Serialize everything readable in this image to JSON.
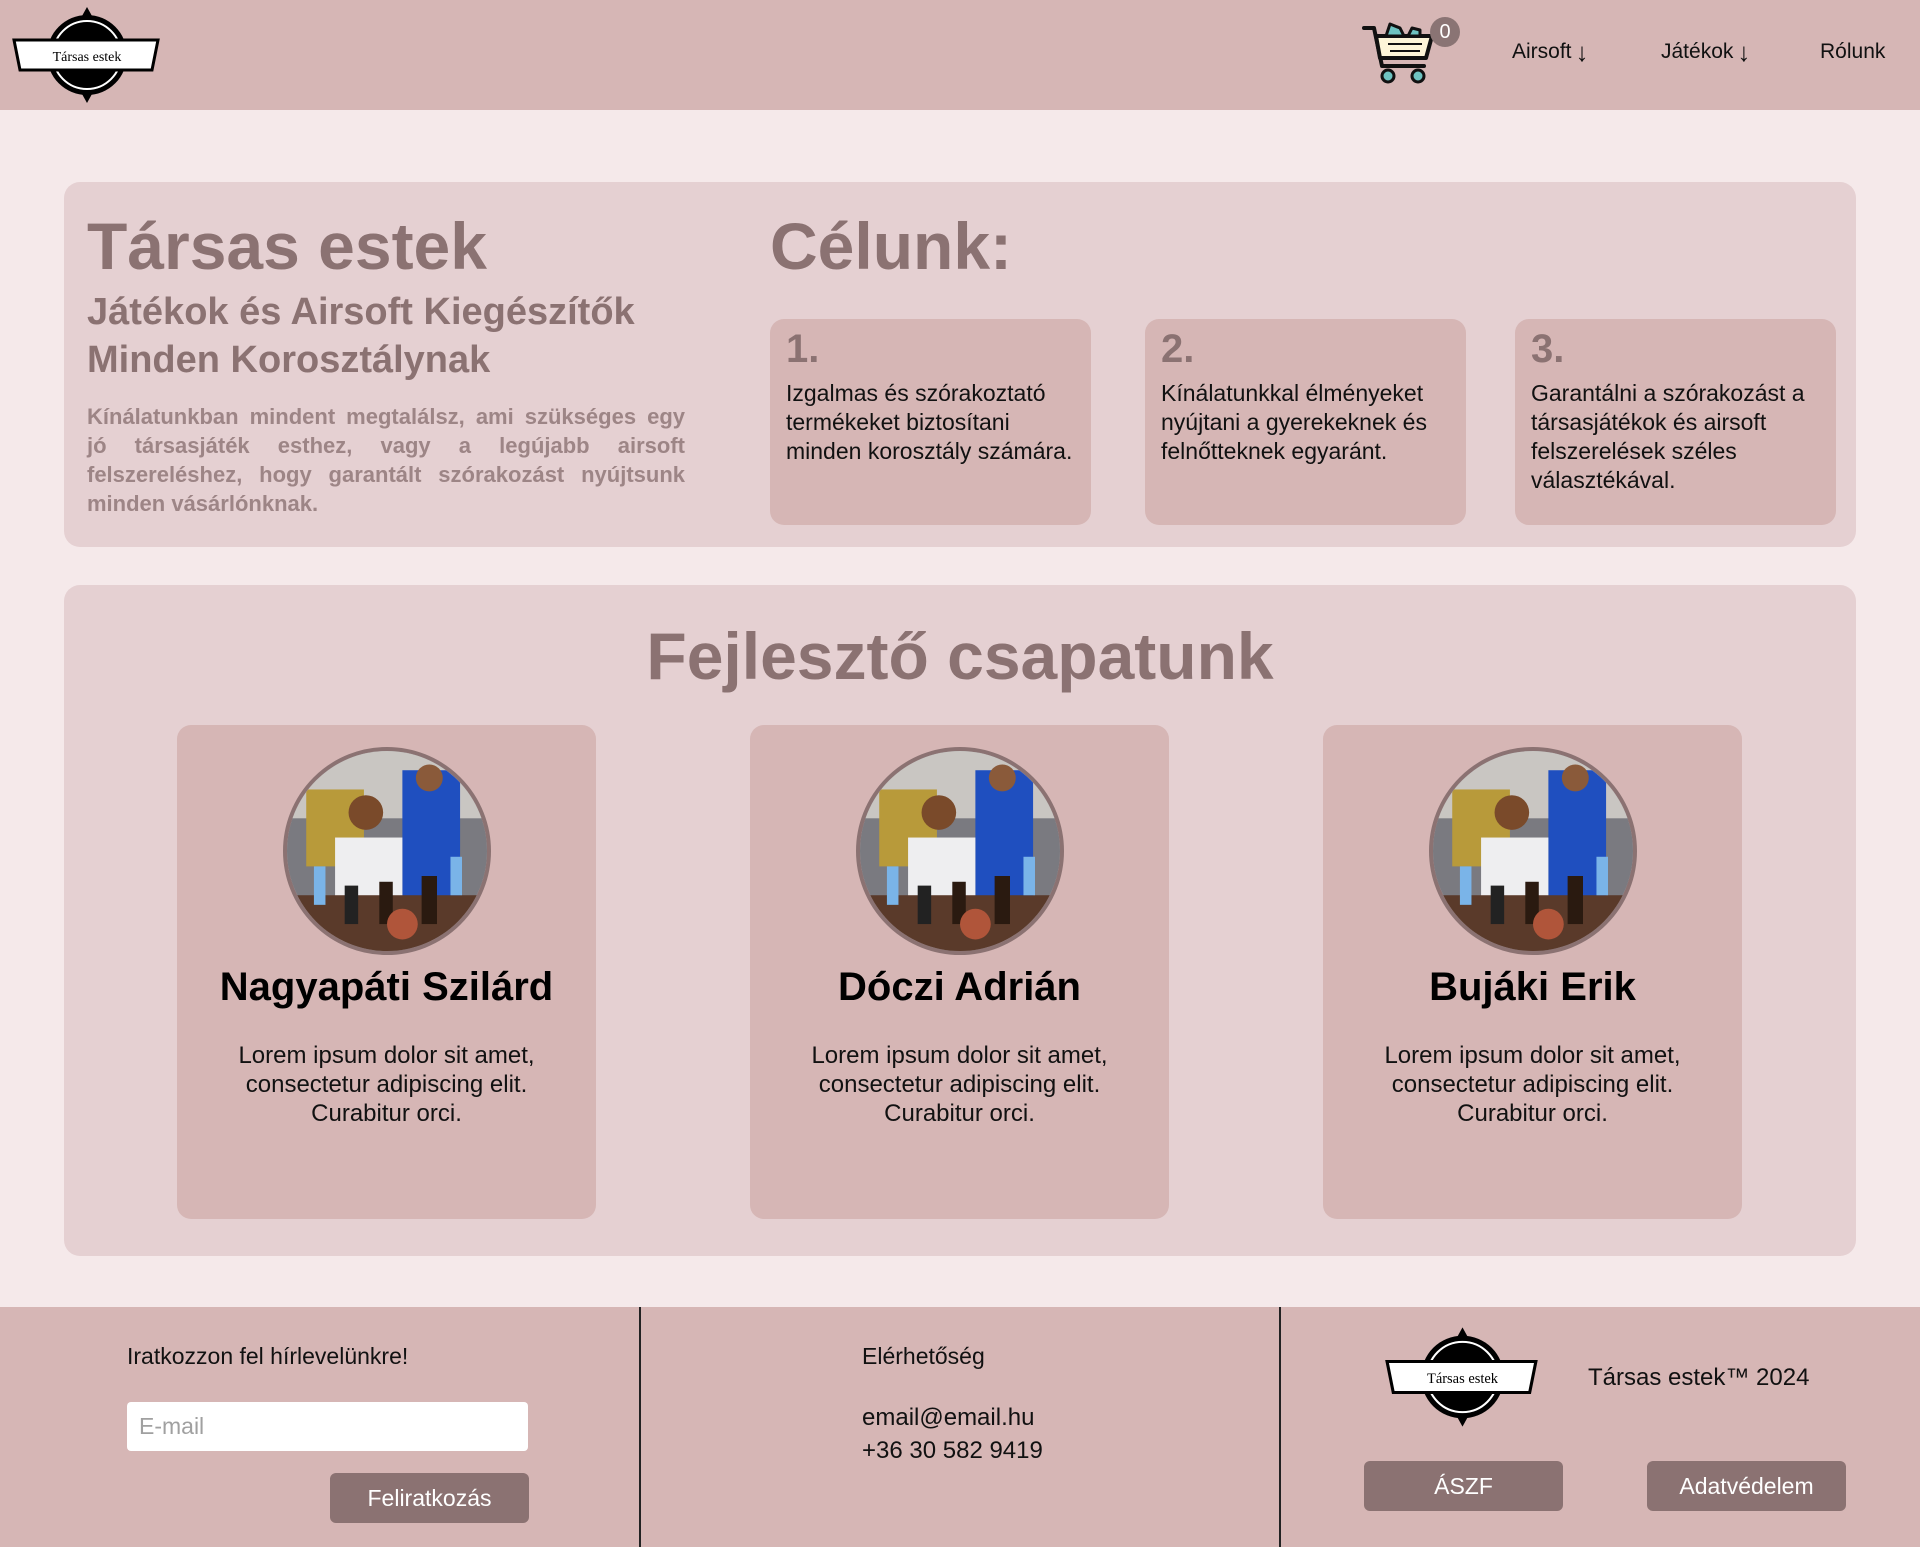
{
  "brand": {
    "logo_text": "Társas estek"
  },
  "header": {
    "cart_count": "0",
    "nav": [
      {
        "label": "Airsoft",
        "arrow": "↓"
      },
      {
        "label": "Játékok",
        "arrow": "↓"
      },
      {
        "label": "Rólunk",
        "arrow": ""
      }
    ]
  },
  "hero": {
    "title": "Társas estek",
    "subtitle": "Játékok és Airsoft Kiegészítők Minden Korosztálynak",
    "description": "Kínálatunkban mindent megtalálsz, ami szükséges egy jó társasjáték esthez, vagy a legújabb airsoft felszereléshez, hogy garantált szórakozást nyújtsunk minden vásárlónknak."
  },
  "goals": {
    "title": "Célunk:",
    "items": [
      {
        "num": "1.",
        "text": "Izgalmas és szórakoztató termékeket biztosítani minden korosztály számára."
      },
      {
        "num": "2.",
        "text": "Kínálatunkkal élményeket nyújtani a gyerekeknek és felnőtteknek egyaránt."
      },
      {
        "num": "3.",
        "text": "Garantálni a szórakozást a társasjátékok és airsoft felszerelések széles választékával."
      }
    ]
  },
  "team": {
    "title": "Fejlesztő csapatunk",
    "members": [
      {
        "name": "Nagyapáti Szilárd",
        "text": "Lorem ipsum dolor sit amet, consectetur adipiscing elit. Curabitur orci."
      },
      {
        "name": "Dóczi Adrián",
        "text": "Lorem ipsum dolor sit amet, consectetur adipiscing elit. Curabitur orci."
      },
      {
        "name": "Bujáki Erik",
        "text": "Lorem ipsum dolor sit amet, consectetur adipiscing elit. Curabitur orci."
      }
    ]
  },
  "footer": {
    "newsletter_label": "Iratkozzon fel hírlevelünkre!",
    "email_placeholder": "E-mail",
    "subscribe_label": "Feliratkozás",
    "contact_label": "Elérhetőség",
    "contact_email": "email@email.hu",
    "contact_phone": "+36 30 582 9419",
    "copyright": "Társas estek™ 2024",
    "aszf_label": "ÁSZF",
    "privacy_label": "Adatvédelem"
  },
  "colors": {
    "header_bg": "#d6b6b5",
    "page_bg": "#f5e9ea",
    "panel_bg": "#e5d0d2",
    "accent_text": "#8b7272",
    "button_bg": "#8b7272"
  }
}
